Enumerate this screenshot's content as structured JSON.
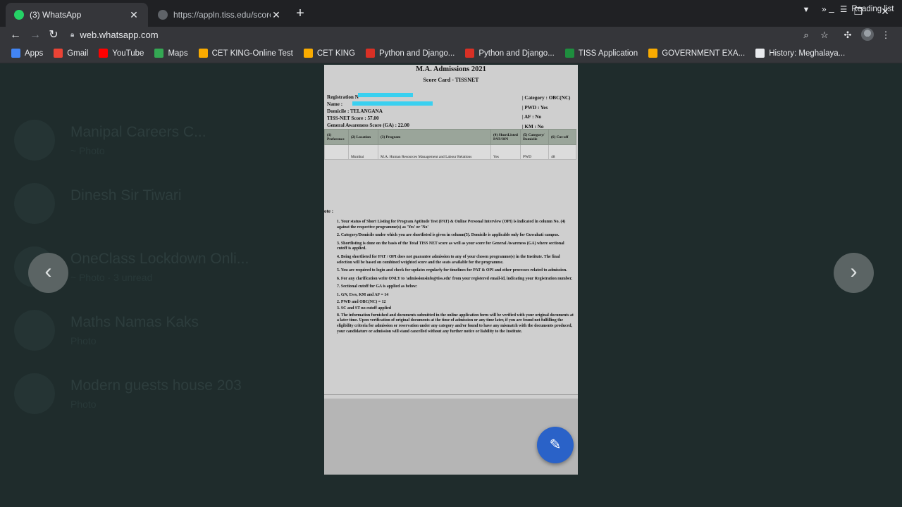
{
  "tabs": [
    {
      "title": "(3) WhatsApp",
      "favicon": "whatsapp-icon",
      "active": true
    },
    {
      "title": "https://appln.tiss.edu/scorecard/",
      "favicon": "globe-icon",
      "active": false
    }
  ],
  "address_bar": {
    "url": "web.whatsapp.com"
  },
  "bookmarks": [
    {
      "label": "Apps",
      "icon": "apps-grid-icon",
      "color": "#4285f4"
    },
    {
      "label": "Gmail",
      "icon": "gmail-icon",
      "color": "#ea4335"
    },
    {
      "label": "YouTube",
      "icon": "youtube-icon",
      "color": "#ff0000"
    },
    {
      "label": "Maps",
      "icon": "maps-icon",
      "color": "#34a853"
    },
    {
      "label": "CET KING-Online Test",
      "icon": "cetking-icon",
      "color": "#f9ab00"
    },
    {
      "label": "CET KING",
      "icon": "cetking-icon",
      "color": "#f9ab00"
    },
    {
      "label": "Python and Django...",
      "icon": "python-django-icon",
      "color": "#d93025"
    },
    {
      "label": "Python and Django...",
      "icon": "python-django-icon",
      "color": "#d93025"
    },
    {
      "label": "TISS Application",
      "icon": "tiss-icon",
      "color": "#1e8e3e"
    },
    {
      "label": "GOVERNMENT EXA...",
      "icon": "govt-icon",
      "color": "#f9ab00"
    },
    {
      "label": "History: Meghalaya...",
      "icon": "globe-icon",
      "color": "#e8eaed"
    }
  ],
  "bookmarks_more": "»",
  "reading_list": "Reading list",
  "background_chats": [
    {
      "name": "Manipal Careers C...",
      "sub": "~ Photo"
    },
    {
      "name": "Dinesh Sir Tiwari",
      "sub": ""
    },
    {
      "name": "OneClass Lockdown Onli...",
      "sub": "~ Photo · 3 unread"
    },
    {
      "name": "Maths Namas Kaks",
      "sub": "Photo"
    },
    {
      "name": "Modern guests house 203",
      "sub": "Photo"
    }
  ],
  "document": {
    "title": "M.A. Admissions 2021",
    "subtitle": "Score Card - TISSNET",
    "left_info": [
      "Registration N",
      "Name :",
      "Domicile : TELANGANA",
      "TISS-NET Score : 57.00",
      "General Awareness Score (GA) : 22.00"
    ],
    "right_info": [
      "| Category : OBC(NC)",
      "| PWD : Yes",
      "| AF : No",
      "| KM : No"
    ],
    "table": {
      "headers": [
        "(1) Preference",
        "(2) Location",
        "(3) Program",
        "(4) ShortListed PAT/OPI",
        "(5) Category/ Domicile",
        "(6) Cut-off"
      ],
      "rows": [
        [
          "",
          "Mumbai",
          "M.A. Human Resources Management and Labour Relations",
          "Yes",
          "PWD",
          "48"
        ]
      ]
    },
    "note_heading": "ote :",
    "notes": [
      "1. Your status of Short Listing for Program Aptitude Test (PAT) & Online Personal Interview (OPI) is indicated in column No. (4) against the respective programme(s) as 'Yes' or 'No'",
      "2. Category/Domicile under which you are shortlisted is given in column(5). Domicile is applicable only for Guwahati campus.",
      "3. Shortlisting is done on the basis of the Total TISS NET score as well as your score for General Awareness (GA) where sectional cutoff is applied.",
      "4. Being shortlisted for PAT / OPI does not guarantee admission to any of your chosen programme(s) in the Institute. The final selection will be based on combined weighted score and the seats available for the programme.",
      "5. You are required to login and check for updates regularly for timelines for PAT & OPI and other processes related to admission.",
      "6. For any clarification write ONLY to 'admissionsinfo@tiss.edu' from your registered email-id, indicating your Registration number.",
      "7. Sectional cutoff for GA is applied as below:",
      "1. GN, Ews, KM and AF = 14",
      "2. PWD and OBC(NC) = 12",
      "3. SC and ST no cutoff applied",
      "8. The information furnished and documents submitted in the online application form will be verified with your original documents at a later time. Upon verification of original documents at the time of admission or any time later, if you are found not fulfilling the eligibility criteria for admission or reservation under any category and/or found to have any mismatch with the documents produced, your candidature or admission will stand cancelled without any further notice or liability to the Institute."
    ]
  },
  "viewer": {
    "prev_icon": "chevron-left-icon",
    "next_icon": "chevron-right-icon",
    "edit_icon": "pencil-icon",
    "fab_color": "#2a62c8"
  }
}
